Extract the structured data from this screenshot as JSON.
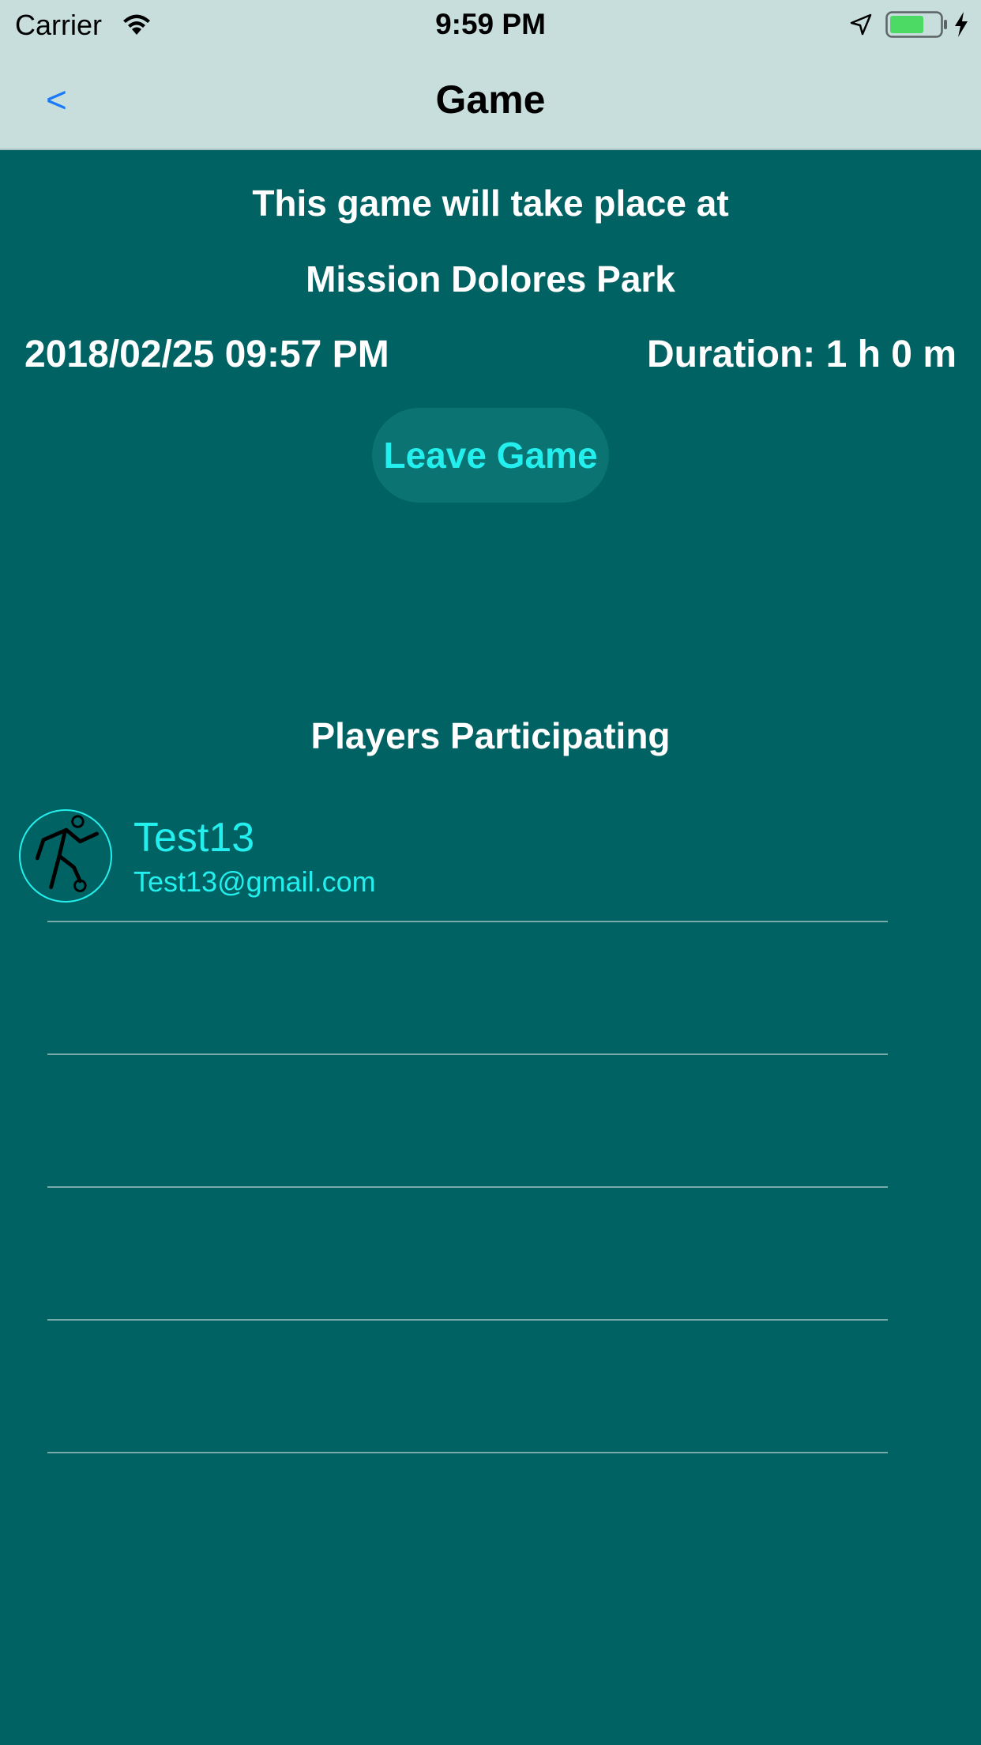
{
  "status_bar": {
    "carrier": "Carrier",
    "time": "9:59 PM",
    "icons": [
      "wifi-icon",
      "location-arrow-icon",
      "battery-icon",
      "charging-icon"
    ],
    "battery_color": "#4cd964"
  },
  "nav": {
    "back_label": "<",
    "title": "Game",
    "background": "#c8dedd",
    "back_color": "#1a7af8"
  },
  "game": {
    "intro": "This game will take place at",
    "location": "Mission Dolores Park",
    "datetime": "2018/02/25 09:57 PM",
    "duration": "Duration: 1 h 0 m",
    "leave_label": "Leave Game",
    "accent_color": "#23f0ee",
    "background": "#006262"
  },
  "players": {
    "heading": "Players Participating",
    "list": [
      {
        "name": "Test13",
        "email": "Test13@gmail.com",
        "avatar_icon": "soccer-player-icon"
      }
    ]
  }
}
